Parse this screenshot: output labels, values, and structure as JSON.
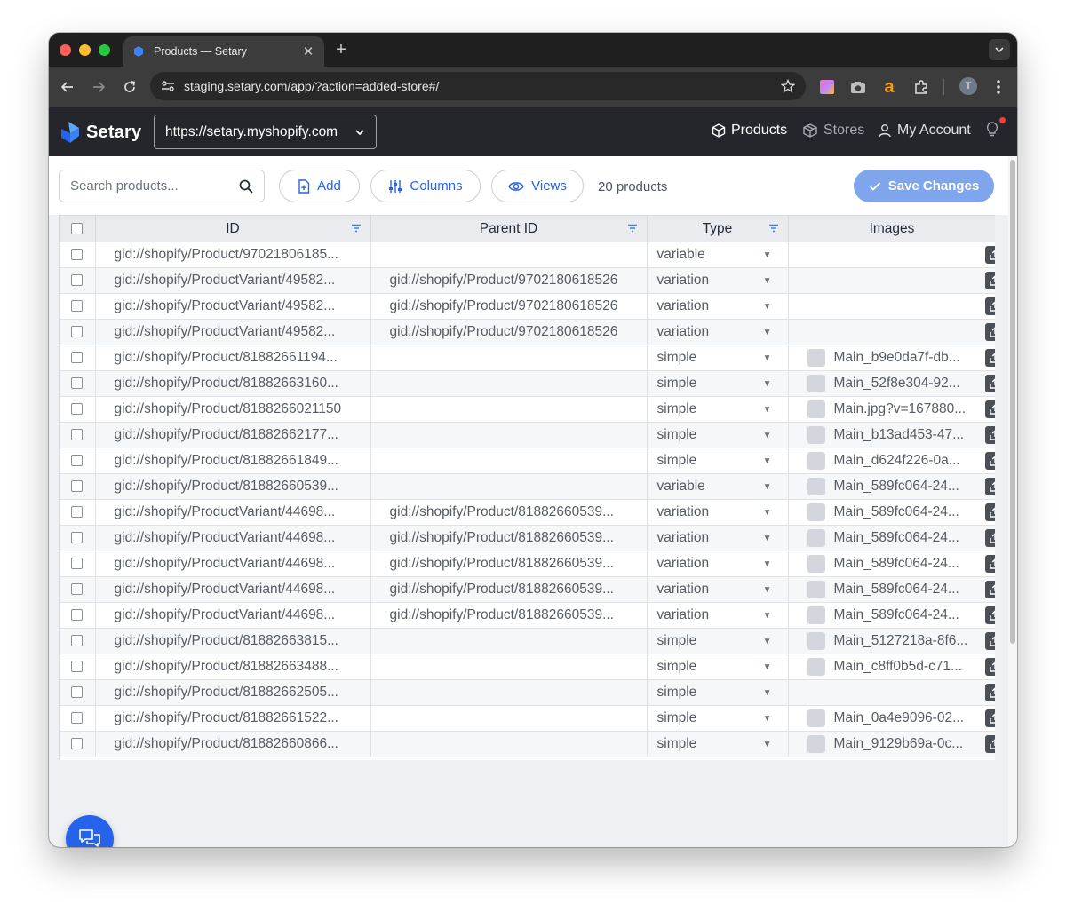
{
  "browser": {
    "tab_title": "Products — Setary",
    "url": "staging.setary.com/app/?action=added-store#/",
    "profile_initial": "T"
  },
  "header": {
    "brand": "Setary",
    "store_url": "https://setary.myshopify.com",
    "nav": {
      "products": "Products",
      "stores": "Stores",
      "account": "My Account"
    }
  },
  "toolbar": {
    "search_placeholder": "Search products...",
    "add_label": "Add",
    "columns_label": "Columns",
    "views_label": "Views",
    "product_count": "20 products",
    "save_label": "Save Changes"
  },
  "table": {
    "columns": [
      "ID",
      "Parent ID",
      "Type",
      "Images"
    ],
    "rows": [
      {
        "id": "gid://shopify/Product/97021806185...",
        "parent": "",
        "type": "variable",
        "image": ""
      },
      {
        "id": "gid://shopify/ProductVariant/49582...",
        "parent": "gid://shopify/Product/9702180618526",
        "type": "variation",
        "image": ""
      },
      {
        "id": "gid://shopify/ProductVariant/49582...",
        "parent": "gid://shopify/Product/9702180618526",
        "type": "variation",
        "image": ""
      },
      {
        "id": "gid://shopify/ProductVariant/49582...",
        "parent": "gid://shopify/Product/9702180618526",
        "type": "variation",
        "image": ""
      },
      {
        "id": "gid://shopify/Product/81882661194...",
        "parent": "",
        "type": "simple",
        "image": "Main_b9e0da7f-db..."
      },
      {
        "id": "gid://shopify/Product/81882663160...",
        "parent": "",
        "type": "simple",
        "image": "Main_52f8e304-92..."
      },
      {
        "id": "gid://shopify/Product/8188266021150",
        "parent": "",
        "type": "simple",
        "image": "Main.jpg?v=167880..."
      },
      {
        "id": "gid://shopify/Product/81882662177...",
        "parent": "",
        "type": "simple",
        "image": "Main_b13ad453-47..."
      },
      {
        "id": "gid://shopify/Product/81882661849...",
        "parent": "",
        "type": "simple",
        "image": "Main_d624f226-0a..."
      },
      {
        "id": "gid://shopify/Product/81882660539...",
        "parent": "",
        "type": "variable",
        "image": "Main_589fc064-24..."
      },
      {
        "id": "gid://shopify/ProductVariant/44698...",
        "parent": "gid://shopify/Product/81882660539...",
        "type": "variation",
        "image": "Main_589fc064-24..."
      },
      {
        "id": "gid://shopify/ProductVariant/44698...",
        "parent": "gid://shopify/Product/81882660539...",
        "type": "variation",
        "image": "Main_589fc064-24..."
      },
      {
        "id": "gid://shopify/ProductVariant/44698...",
        "parent": "gid://shopify/Product/81882660539...",
        "type": "variation",
        "image": "Main_589fc064-24..."
      },
      {
        "id": "gid://shopify/ProductVariant/44698...",
        "parent": "gid://shopify/Product/81882660539...",
        "type": "variation",
        "image": "Main_589fc064-24..."
      },
      {
        "id": "gid://shopify/ProductVariant/44698...",
        "parent": "gid://shopify/Product/81882660539...",
        "type": "variation",
        "image": "Main_589fc064-24..."
      },
      {
        "id": "gid://shopify/Product/81882663815...",
        "parent": "",
        "type": "simple",
        "image": "Main_5127218a-8f6..."
      },
      {
        "id": "gid://shopify/Product/81882663488...",
        "parent": "",
        "type": "simple",
        "image": "Main_c8ff0b5d-c71..."
      },
      {
        "id": "gid://shopify/Product/81882662505...",
        "parent": "",
        "type": "simple",
        "image": ""
      },
      {
        "id": "gid://shopify/Product/81882661522...",
        "parent": "",
        "type": "simple",
        "image": "Main_0a4e9096-02..."
      },
      {
        "id": "gid://shopify/Product/81882660866...",
        "parent": "",
        "type": "simple",
        "image": "Main_9129b69a-0c..."
      }
    ]
  },
  "colors": {
    "brand_blue": "#2563eb",
    "save_button": "#7fa5ec",
    "header_bg": "#24262b",
    "notification_dot": "#ff3b30"
  },
  "icons": {
    "search": "search-icon",
    "add": "add-file-icon",
    "columns": "sliders-icon",
    "views": "eye-icon",
    "save": "check-icon",
    "upload": "upload-icon",
    "chat": "chat-icon"
  }
}
